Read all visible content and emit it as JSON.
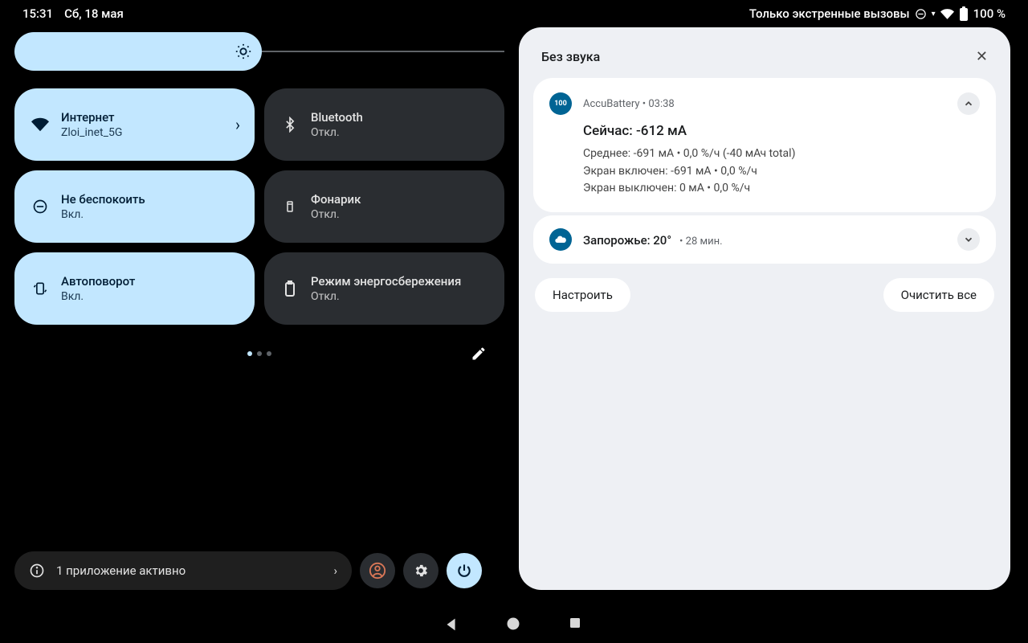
{
  "status": {
    "time": "15:31",
    "date": "Сб, 18 мая",
    "emergency": "Только экстренные вызовы",
    "battery_pct": "100 %"
  },
  "tiles": [
    {
      "title": "Интернет",
      "sub": "Zloi_inet_5G",
      "on": true,
      "icon": "wifi",
      "chevron": true
    },
    {
      "title": "Bluetooth",
      "sub": "Откл.",
      "on": false,
      "icon": "bluetooth"
    },
    {
      "title": "Не беспокоить",
      "sub": "Вкл.",
      "on": true,
      "icon": "dnd"
    },
    {
      "title": "Фонарик",
      "sub": "Откл.",
      "on": false,
      "icon": "flashlight"
    },
    {
      "title": "Автоповорот",
      "sub": "Вкл.",
      "on": true,
      "icon": "rotate"
    },
    {
      "title": "Режим энергосбережения",
      "sub": "Откл.",
      "on": false,
      "icon": "battery"
    }
  ],
  "footer": {
    "running": "1 приложение активно"
  },
  "notif": {
    "header": "Без звука",
    "accubattery": {
      "app": "AccuBattery",
      "time": "03:38",
      "title": "Сейчас: -612 мА",
      "line1": "Среднее: -691 мА • 0,0 %/ч (-40 мАч total)",
      "line2": "Экран включен: -691 мА • 0,0 %/ч",
      "line3": "Экран выключен: 0 мА • 0,0 %/ч"
    },
    "weather": {
      "title": "Запорожье: 20°",
      "time": "28 мин."
    },
    "actions": {
      "configure": "Настроить",
      "clear": "Очистить все"
    }
  }
}
